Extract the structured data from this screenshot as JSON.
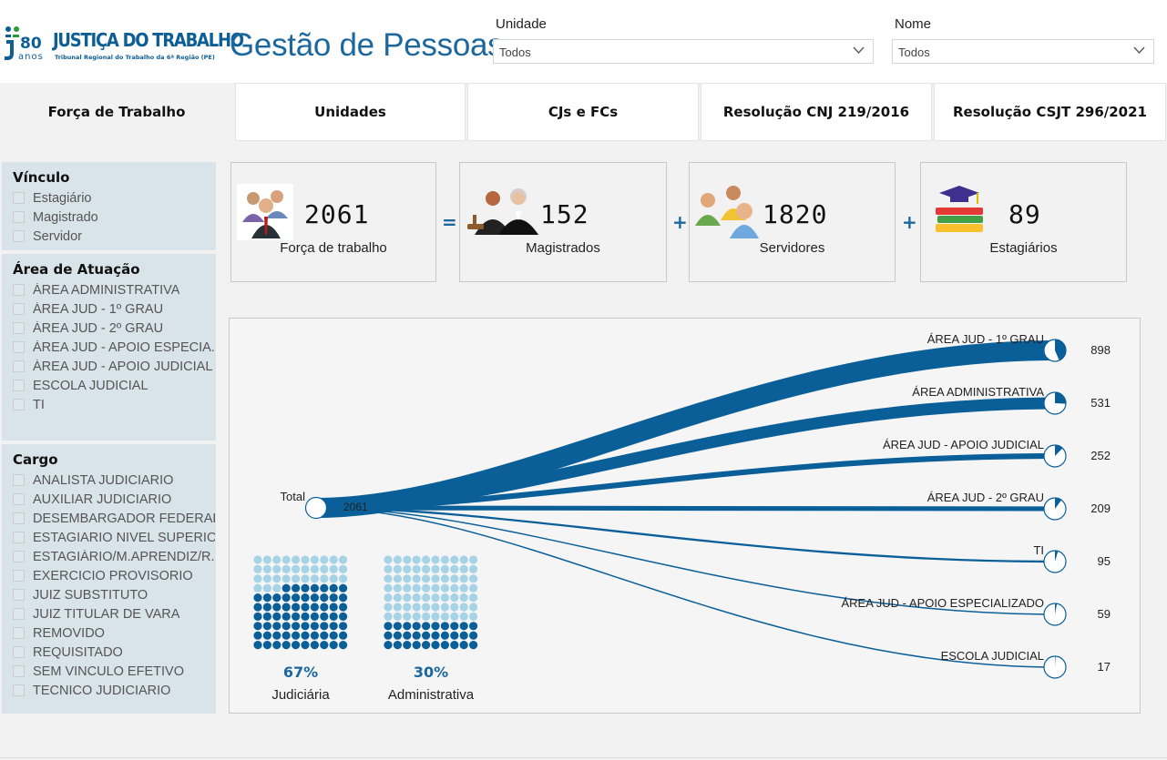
{
  "header": {
    "logo_number": "80",
    "logo_anos": "anos",
    "logo_title": "JUSTIÇA DO TRABALHO",
    "logo_subtitle": "Tribunal Regional do Trabalho da 6ª Região (PE)",
    "page_title": "Gestão de Pessoas",
    "filters": [
      {
        "label": "Unidade",
        "value": "Todos"
      },
      {
        "label": "Nome",
        "value": "Todos"
      }
    ]
  },
  "tabs": [
    {
      "label": "Força de Trabalho",
      "active": true
    },
    {
      "label": "Unidades",
      "active": false
    },
    {
      "label": "CJs e FCs",
      "active": false
    },
    {
      "label": "Resolução CNJ 219/2016",
      "active": false
    },
    {
      "label": "Resolução CSJT 296/2021",
      "active": false
    }
  ],
  "slicers": {
    "vinculo": {
      "title": "Vínculo",
      "items": [
        "Estagiário",
        "Magistrado",
        "Servidor"
      ]
    },
    "area": {
      "title": "Área de Atuação",
      "items": [
        "ÁREA ADMINISTRATIVA",
        "ÁREA JUD - 1º GRAU",
        "ÁREA JUD - 2º GRAU",
        "ÁREA JUD - APOIO ESPECIA...",
        "ÁREA JUD - APOIO JUDICIAL",
        "ESCOLA JUDICIAL",
        "TI"
      ]
    },
    "cargo": {
      "title": "Cargo",
      "items": [
        "ANALISTA JUDICIARIO",
        "AUXILIAR JUDICIARIO",
        "DESEMBARGADOR FEDERAL",
        "ESTAGIARIO NIVEL SUPERIOR",
        "ESTAGIÁRIO/M.APRENDIZ/R....",
        "EXERCICIO PROVISORIO",
        "JUIZ SUBSTITUTO",
        "JUIZ TITULAR DE VARA",
        "REMOVIDO",
        "REQUISITADO",
        "SEM VINCULO EFETIVO",
        "TECNICO JUDICIARIO"
      ]
    }
  },
  "cards": {
    "forca": {
      "value": "2061",
      "label": "Força de trabalho",
      "icon": "workforce-people-icon"
    },
    "magistrados": {
      "value": "152",
      "label": "Magistrados",
      "icon": "judges-icon"
    },
    "servidores": {
      "value": "1820",
      "label": "Servidores",
      "icon": "servants-group-icon"
    },
    "estagiarios": {
      "value": "89",
      "label": "Estagiários",
      "icon": "graduation-books-icon"
    },
    "operators": [
      "=",
      "+",
      "+"
    ]
  },
  "decomposition": {
    "root_label": "Total",
    "root_value": "2061",
    "root_total": 2061,
    "nodes": [
      {
        "label": "ÁREA JUD - 1º GRAU",
        "value": 898
      },
      {
        "label": "ÁREA ADMINISTRATIVA",
        "value": 531
      },
      {
        "label": "ÁREA JUD - APOIO JUDICIAL",
        "value": 252
      },
      {
        "label": "ÁREA JUD - 2º GRAU",
        "value": 209
      },
      {
        "label": "TI",
        "value": 95
      },
      {
        "label": "ÁREA JUD - APOIO ESPECIALIZADO",
        "value": 59
      },
      {
        "label": "ESCOLA JUDICIAL",
        "value": 17
      }
    ]
  },
  "waffles": [
    {
      "percent_text": "67%",
      "label": "Judiciária",
      "fraction": 0.67
    },
    {
      "percent_text": "30%",
      "label": "Administrativa",
      "fraction": 0.3
    }
  ],
  "colors": {
    "primary": "#0a5f99",
    "title_blue": "#1b679e",
    "waffle_dark": "#0a5f99",
    "waffle_light": "#a7d3e6",
    "slicer_bg": "#d9e3ea"
  }
}
